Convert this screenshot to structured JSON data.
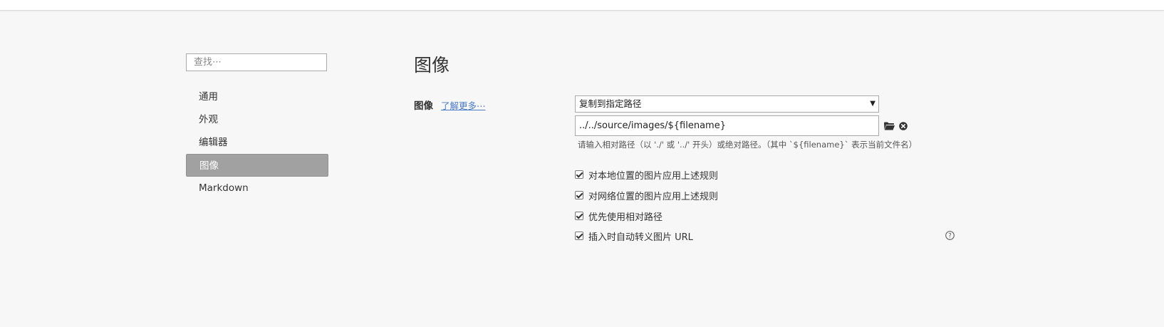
{
  "sidebar": {
    "search_placeholder": "查找⋯",
    "items": [
      {
        "label": "通用"
      },
      {
        "label": "外观"
      },
      {
        "label": "编辑器"
      },
      {
        "label": "图像",
        "active": true
      },
      {
        "label": "Markdown"
      }
    ]
  },
  "main": {
    "title": "图像",
    "section_label": "图像",
    "learn_more": "了解更多⋯",
    "action_select": "复制到指定路径",
    "path_value": "../../source/images/${filename}",
    "hint": "请输入相对路径（以 './' 或 '../' 开头）或绝对路径。（其中 `${filename}` 表示当前文件名）",
    "checkboxes": [
      {
        "label": "对本地位置的图片应用上述规则",
        "checked": true
      },
      {
        "label": "对网络位置的图片应用上述规则",
        "checked": true
      },
      {
        "label": "优先使用相对路径",
        "checked": true
      },
      {
        "label": "插入时自动转义图片 URL",
        "checked": true
      }
    ]
  },
  "icons": {
    "folder": "folder-icon",
    "clear": "close-circle-icon",
    "help": "help-icon"
  }
}
